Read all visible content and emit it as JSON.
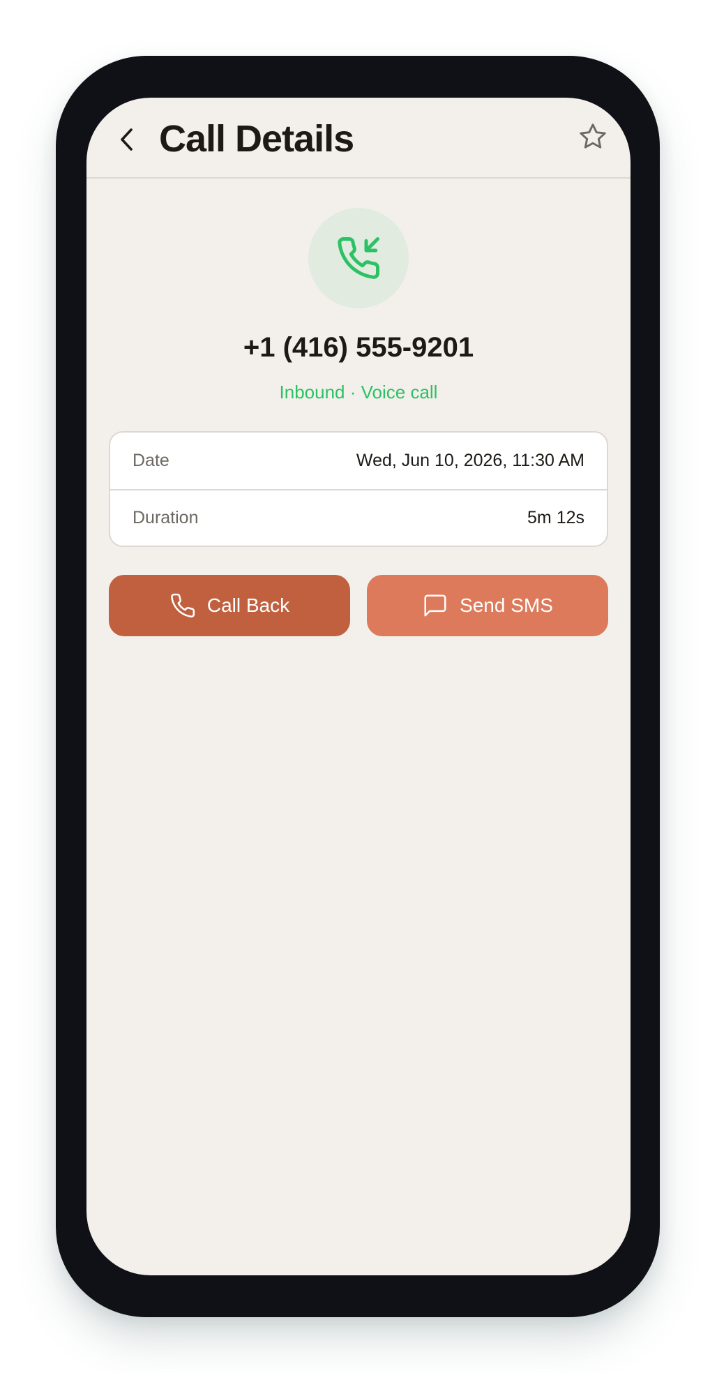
{
  "header": {
    "title": "Call Details",
    "back_icon": "chevron-left-icon",
    "star_icon": "star-icon"
  },
  "call": {
    "icon": "phone-incoming-icon",
    "number": "+1 (416) 555-9201",
    "subtitle": "Inbound · Voice call"
  },
  "details": [
    {
      "label": "Date",
      "value": "Wed, Jun 10, 2026, 11:30 AM"
    },
    {
      "label": "Duration",
      "value": "5m 12s"
    }
  ],
  "actions": {
    "call_back": {
      "label": "Call Back",
      "icon": "phone-icon"
    },
    "send_sms": {
      "label": "Send SMS",
      "icon": "message-icon"
    }
  },
  "colors": {
    "accent": "#c0603f",
    "accent_light": "#dc7a5b",
    "inbound_green": "#2cc164",
    "background": "#f3f0eb",
    "frame": "#0f1117"
  }
}
